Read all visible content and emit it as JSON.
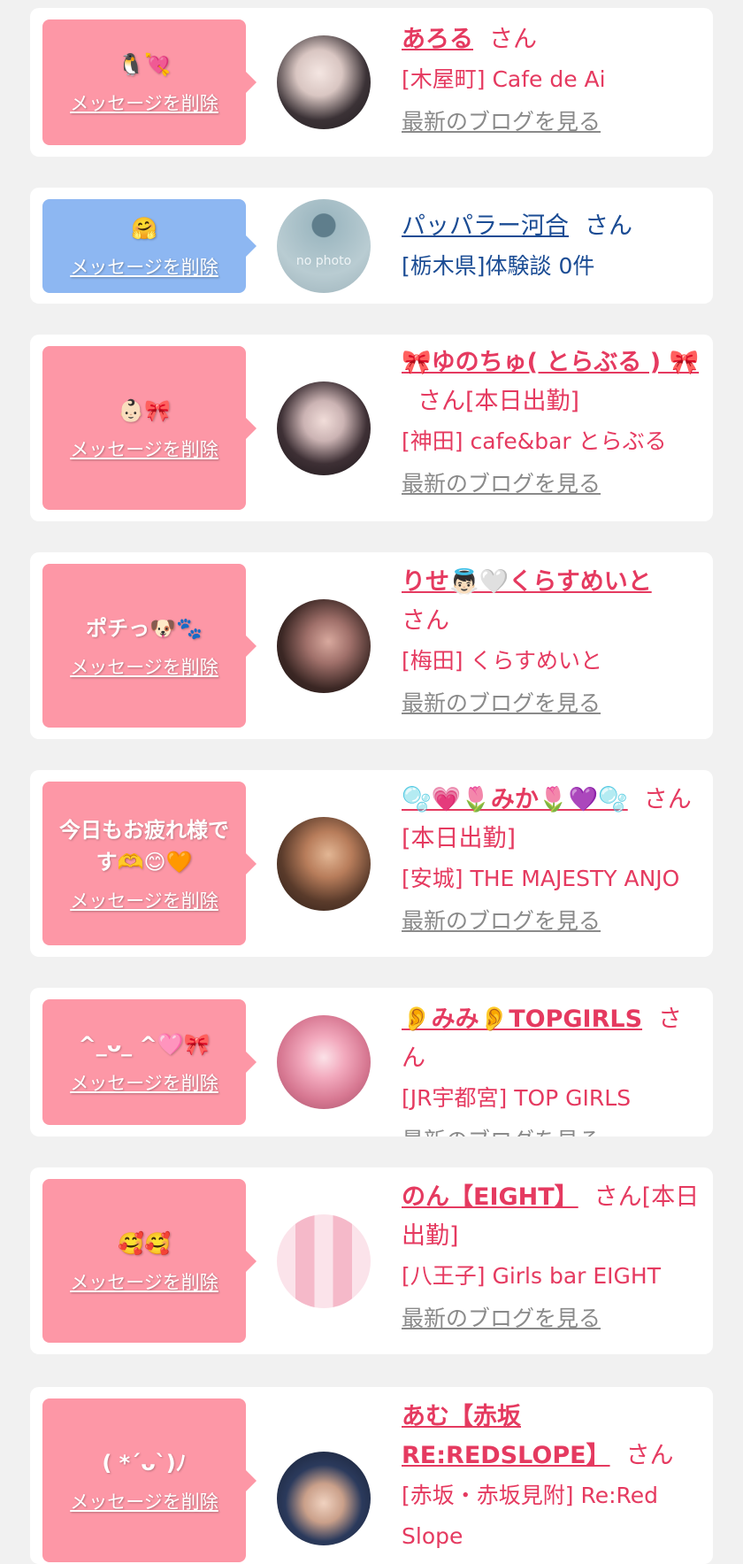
{
  "delete_label": "メッセージを削除",
  "blog_label": "最新のブログを見る",
  "colors": {
    "pink_bubble": "#fd97a6",
    "blue_bubble": "#8db7f2",
    "name_pink": "#e53a60",
    "name_blue": "#1b4c94",
    "link_gray": "#8a8a8a"
  },
  "entries": [
    {
      "message": "🐧💘",
      "name": "あろる",
      "suffix": "さん",
      "shop": "[木屋町] Cafe de Ai",
      "blog": "最新のブログを見る"
    },
    {
      "message": "🤗",
      "name": "パッパラー河合",
      "suffix": "さん",
      "shop": "[栃木県]体験談 0件",
      "avatar_text": "no photo"
    },
    {
      "message": "👶🏻🎀",
      "name": "🎀ゆのちゅ( とらぶる ) 🎀",
      "suffix": "さん[本日出勤]",
      "shop": "[神田] cafe&bar とらぶる",
      "blog": "最新のブログを見る"
    },
    {
      "message": "ポチっ🐶🐾",
      "name": "りせ👼🏻🤍くらすめいと",
      "suffix": "さん",
      "shop": "[梅田] くらすめいと",
      "blog": "最新のブログを見る"
    },
    {
      "message": "今日もお疲れ様です🫶😊🧡",
      "name": "🫧💗🌷みか🌷💜🫧",
      "suffix": "さん[本日出勤]",
      "shop": "[安城] THE MAJESTY ANJO",
      "blog": "最新のブログを見る"
    },
    {
      "message": "^_ᴗ_ ^🩷🎀",
      "name": "👂みみ👂TOPGIRLS",
      "suffix": "さん",
      "shop": "[JR宇都宮] TOP GIRLS",
      "blog": "最新のブログを見る"
    },
    {
      "message": "🥰🥰",
      "name": "のん【EIGHT】",
      "suffix": "さん[本日出勤]",
      "shop": "[八王子] Girls bar EIGHT",
      "blog": "最新のブログを見る"
    },
    {
      "message": "( *´ᴗ`)ﾉ",
      "name": "あむ【赤坂RE:REDSLOPE】",
      "suffix": "さん",
      "shop": "[赤坂・赤坂見附] Re:Red Slope"
    }
  ]
}
